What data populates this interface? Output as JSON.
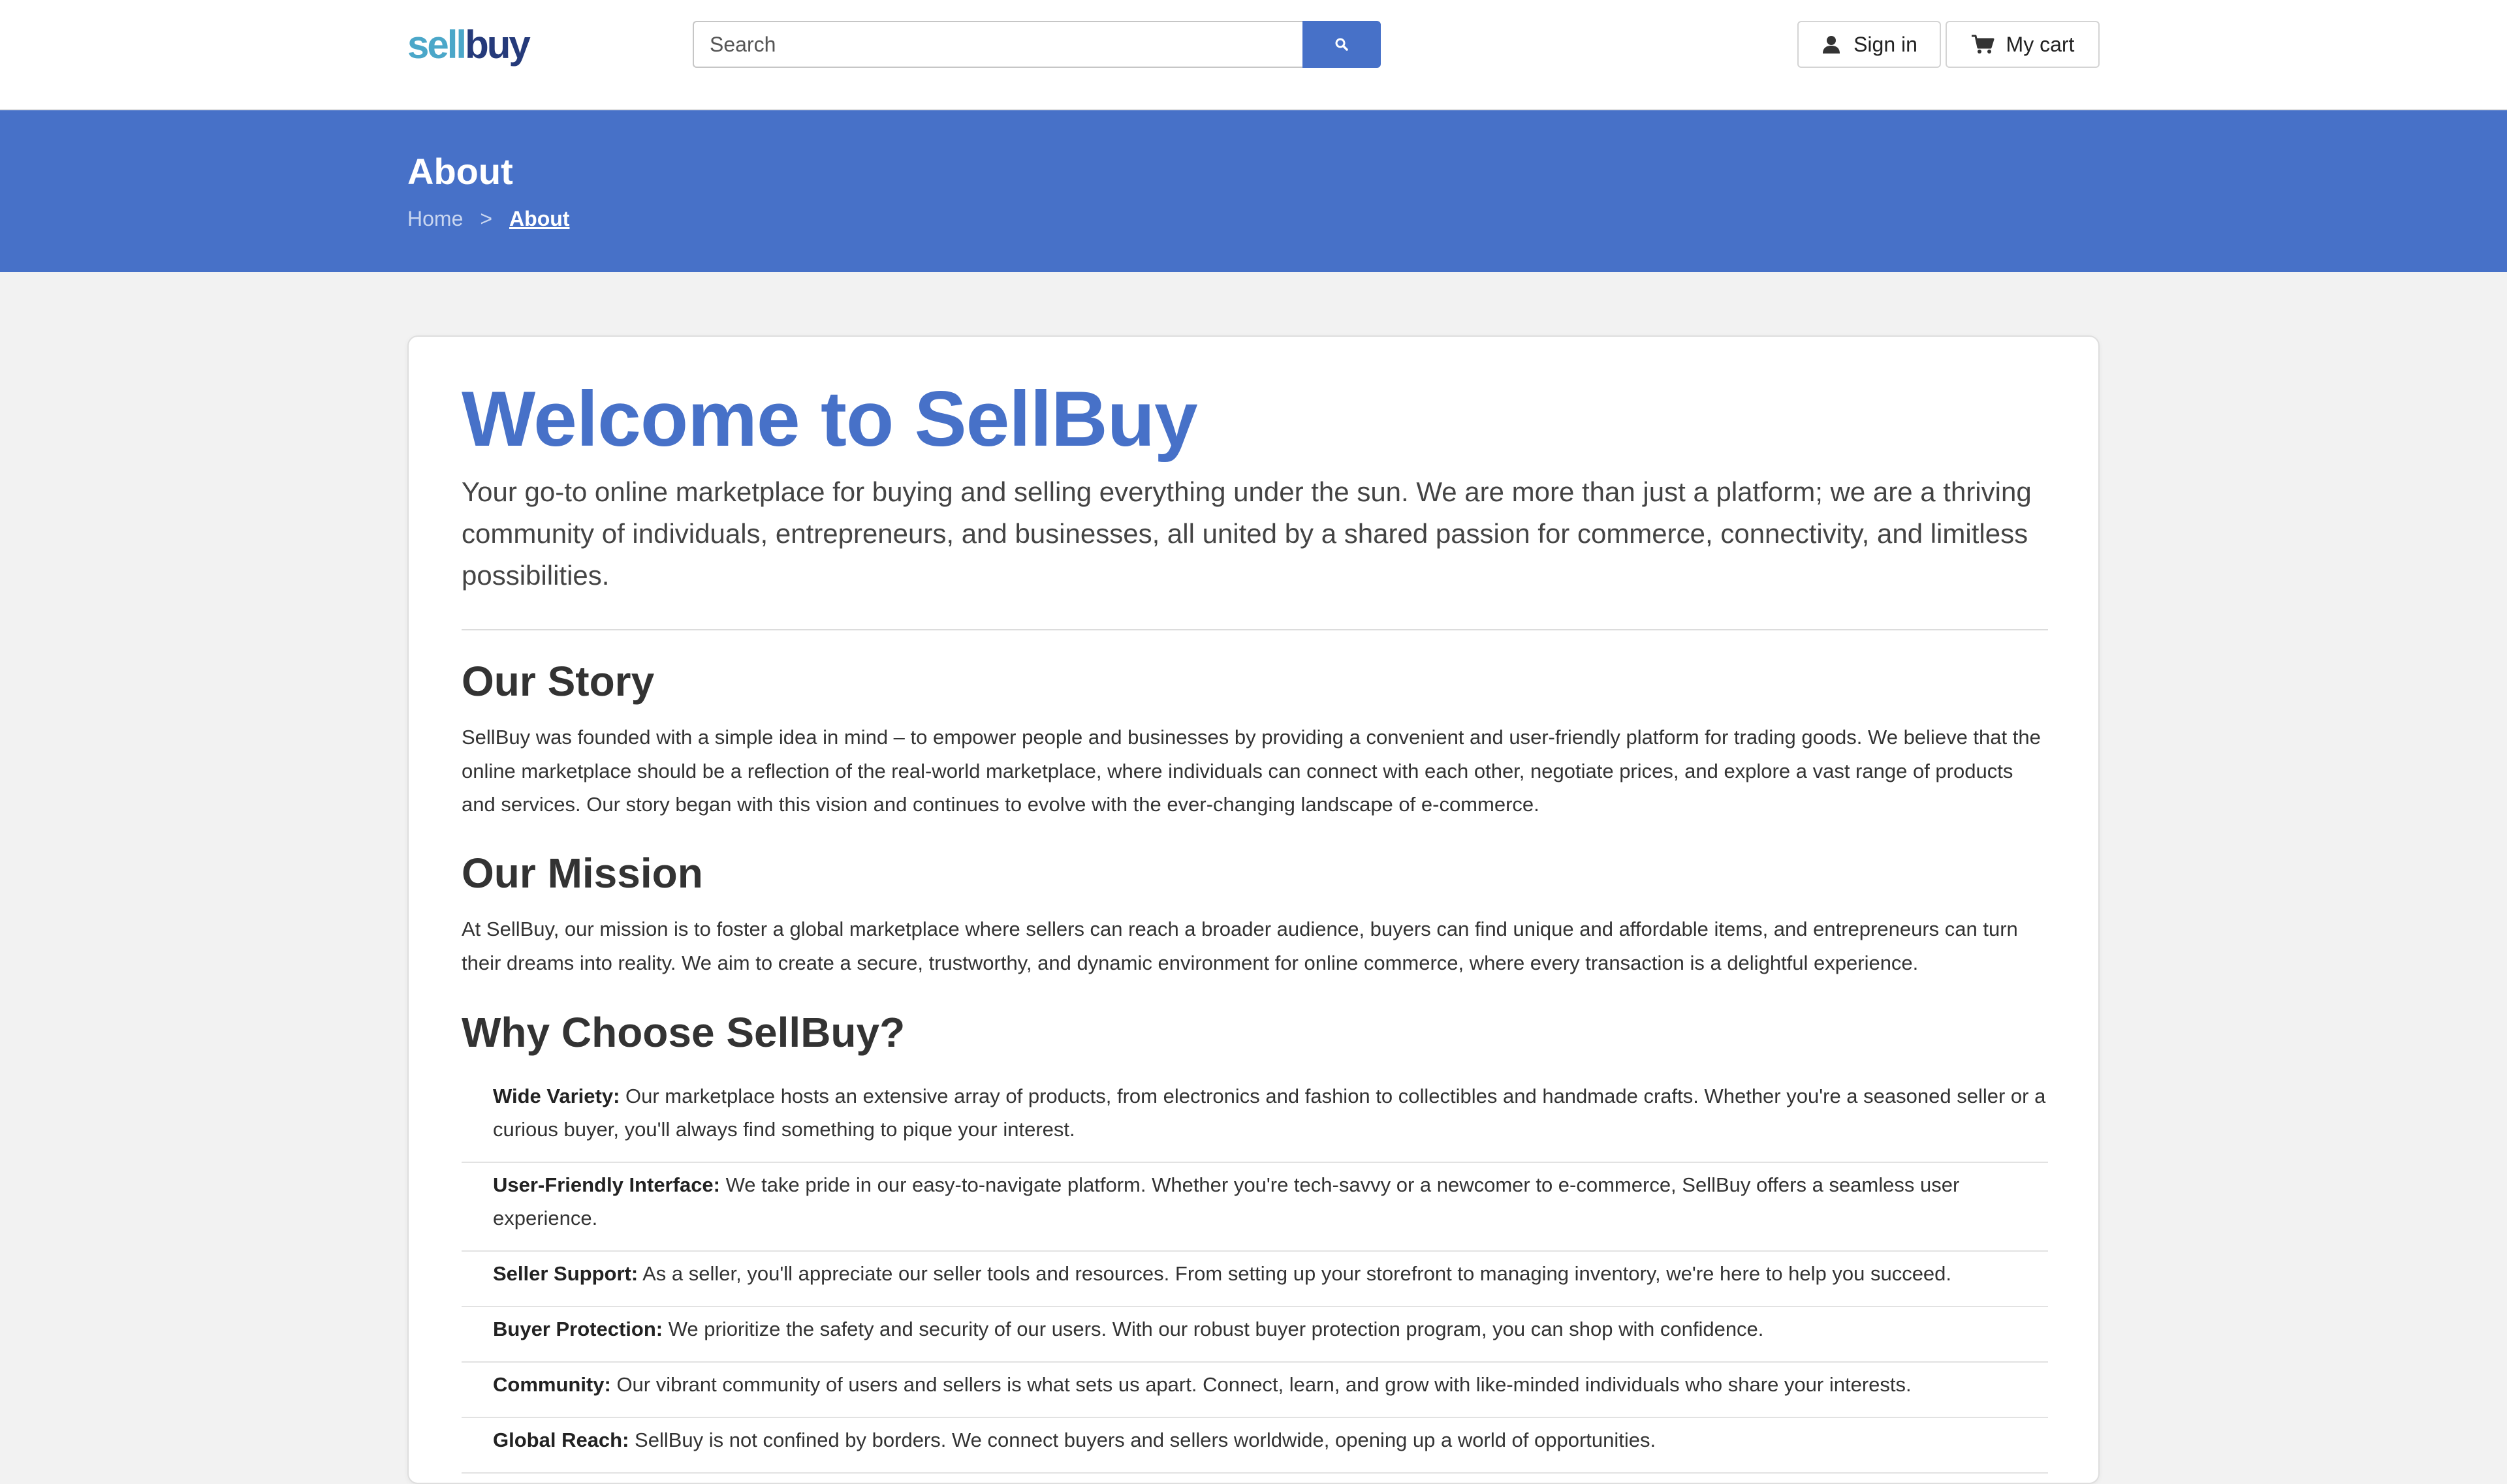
{
  "header": {
    "logo_sell": "sell",
    "logo_buy": "buy",
    "search_placeholder": "Search",
    "search_icon": "search-icon",
    "signin_label": "Sign in",
    "signin_icon": "user-icon",
    "cart_label": "My cart",
    "cart_icon": "cart-icon"
  },
  "band": {
    "title": "About",
    "breadcrumb": {
      "home": "Home",
      "separator": ">",
      "current": "About"
    }
  },
  "content": {
    "welcome": "Welcome to SellBuy",
    "lead": "Your go-to online marketplace for buying and selling everything under the sun. We are more than just a platform; we are a thriving community of individuals, entrepreneurs, and businesses, all united by a shared passion for commerce, connectivity, and limitless possibilities.",
    "story_title": "Our Story",
    "story_text": "SellBuy was founded with a simple idea in mind – to empower people and businesses by providing a convenient and user-friendly platform for trading goods. We believe that the online marketplace should be a reflection of the real-world marketplace, where individuals can connect with each other, negotiate prices, and explore a vast range of products and services. Our story began with this vision and continues to evolve with the ever-changing landscape of e-commerce.",
    "mission_title": "Our Mission",
    "mission_text": "At SellBuy, our mission is to foster a global marketplace where sellers can reach a broader audience, buyers can find unique and affordable items, and entrepreneurs can turn their dreams into reality. We aim to create a secure, trustworthy, and dynamic environment for online commerce, where every transaction is a delightful experience.",
    "why_title": "Why Choose SellBuy?",
    "why_items": [
      {
        "term": "Wide Variety:",
        "text": " Our marketplace hosts an extensive array of products, from electronics and fashion to collectibles and handmade crafts. Whether you're a seasoned seller or a curious buyer, you'll always find something to pique your interest."
      },
      {
        "term": "User-Friendly Interface:",
        "text": " We take pride in our easy-to-navigate platform. Whether you're tech-savvy or a newcomer to e-commerce, SellBuy offers a seamless user experience."
      },
      {
        "term": "Seller Support:",
        "text": " As a seller, you'll appreciate our seller tools and resources. From setting up your storefront to managing inventory, we're here to help you succeed."
      },
      {
        "term": "Buyer Protection:",
        "text": " We prioritize the safety and security of our users. With our robust buyer protection program, you can shop with confidence."
      },
      {
        "term": "Community:",
        "text": " Our vibrant community of users and sellers is what sets us apart. Connect, learn, and grow with like-minded individuals who share your interests."
      },
      {
        "term": "Global Reach:",
        "text": " SellBuy is not confined by borders. We connect buyers and sellers worldwide, opening up a world of opportunities."
      }
    ]
  },
  "colors": {
    "brand_blue": "#4771c8",
    "logo_sell": "#4ba7c9",
    "logo_buy": "#253a7a"
  }
}
